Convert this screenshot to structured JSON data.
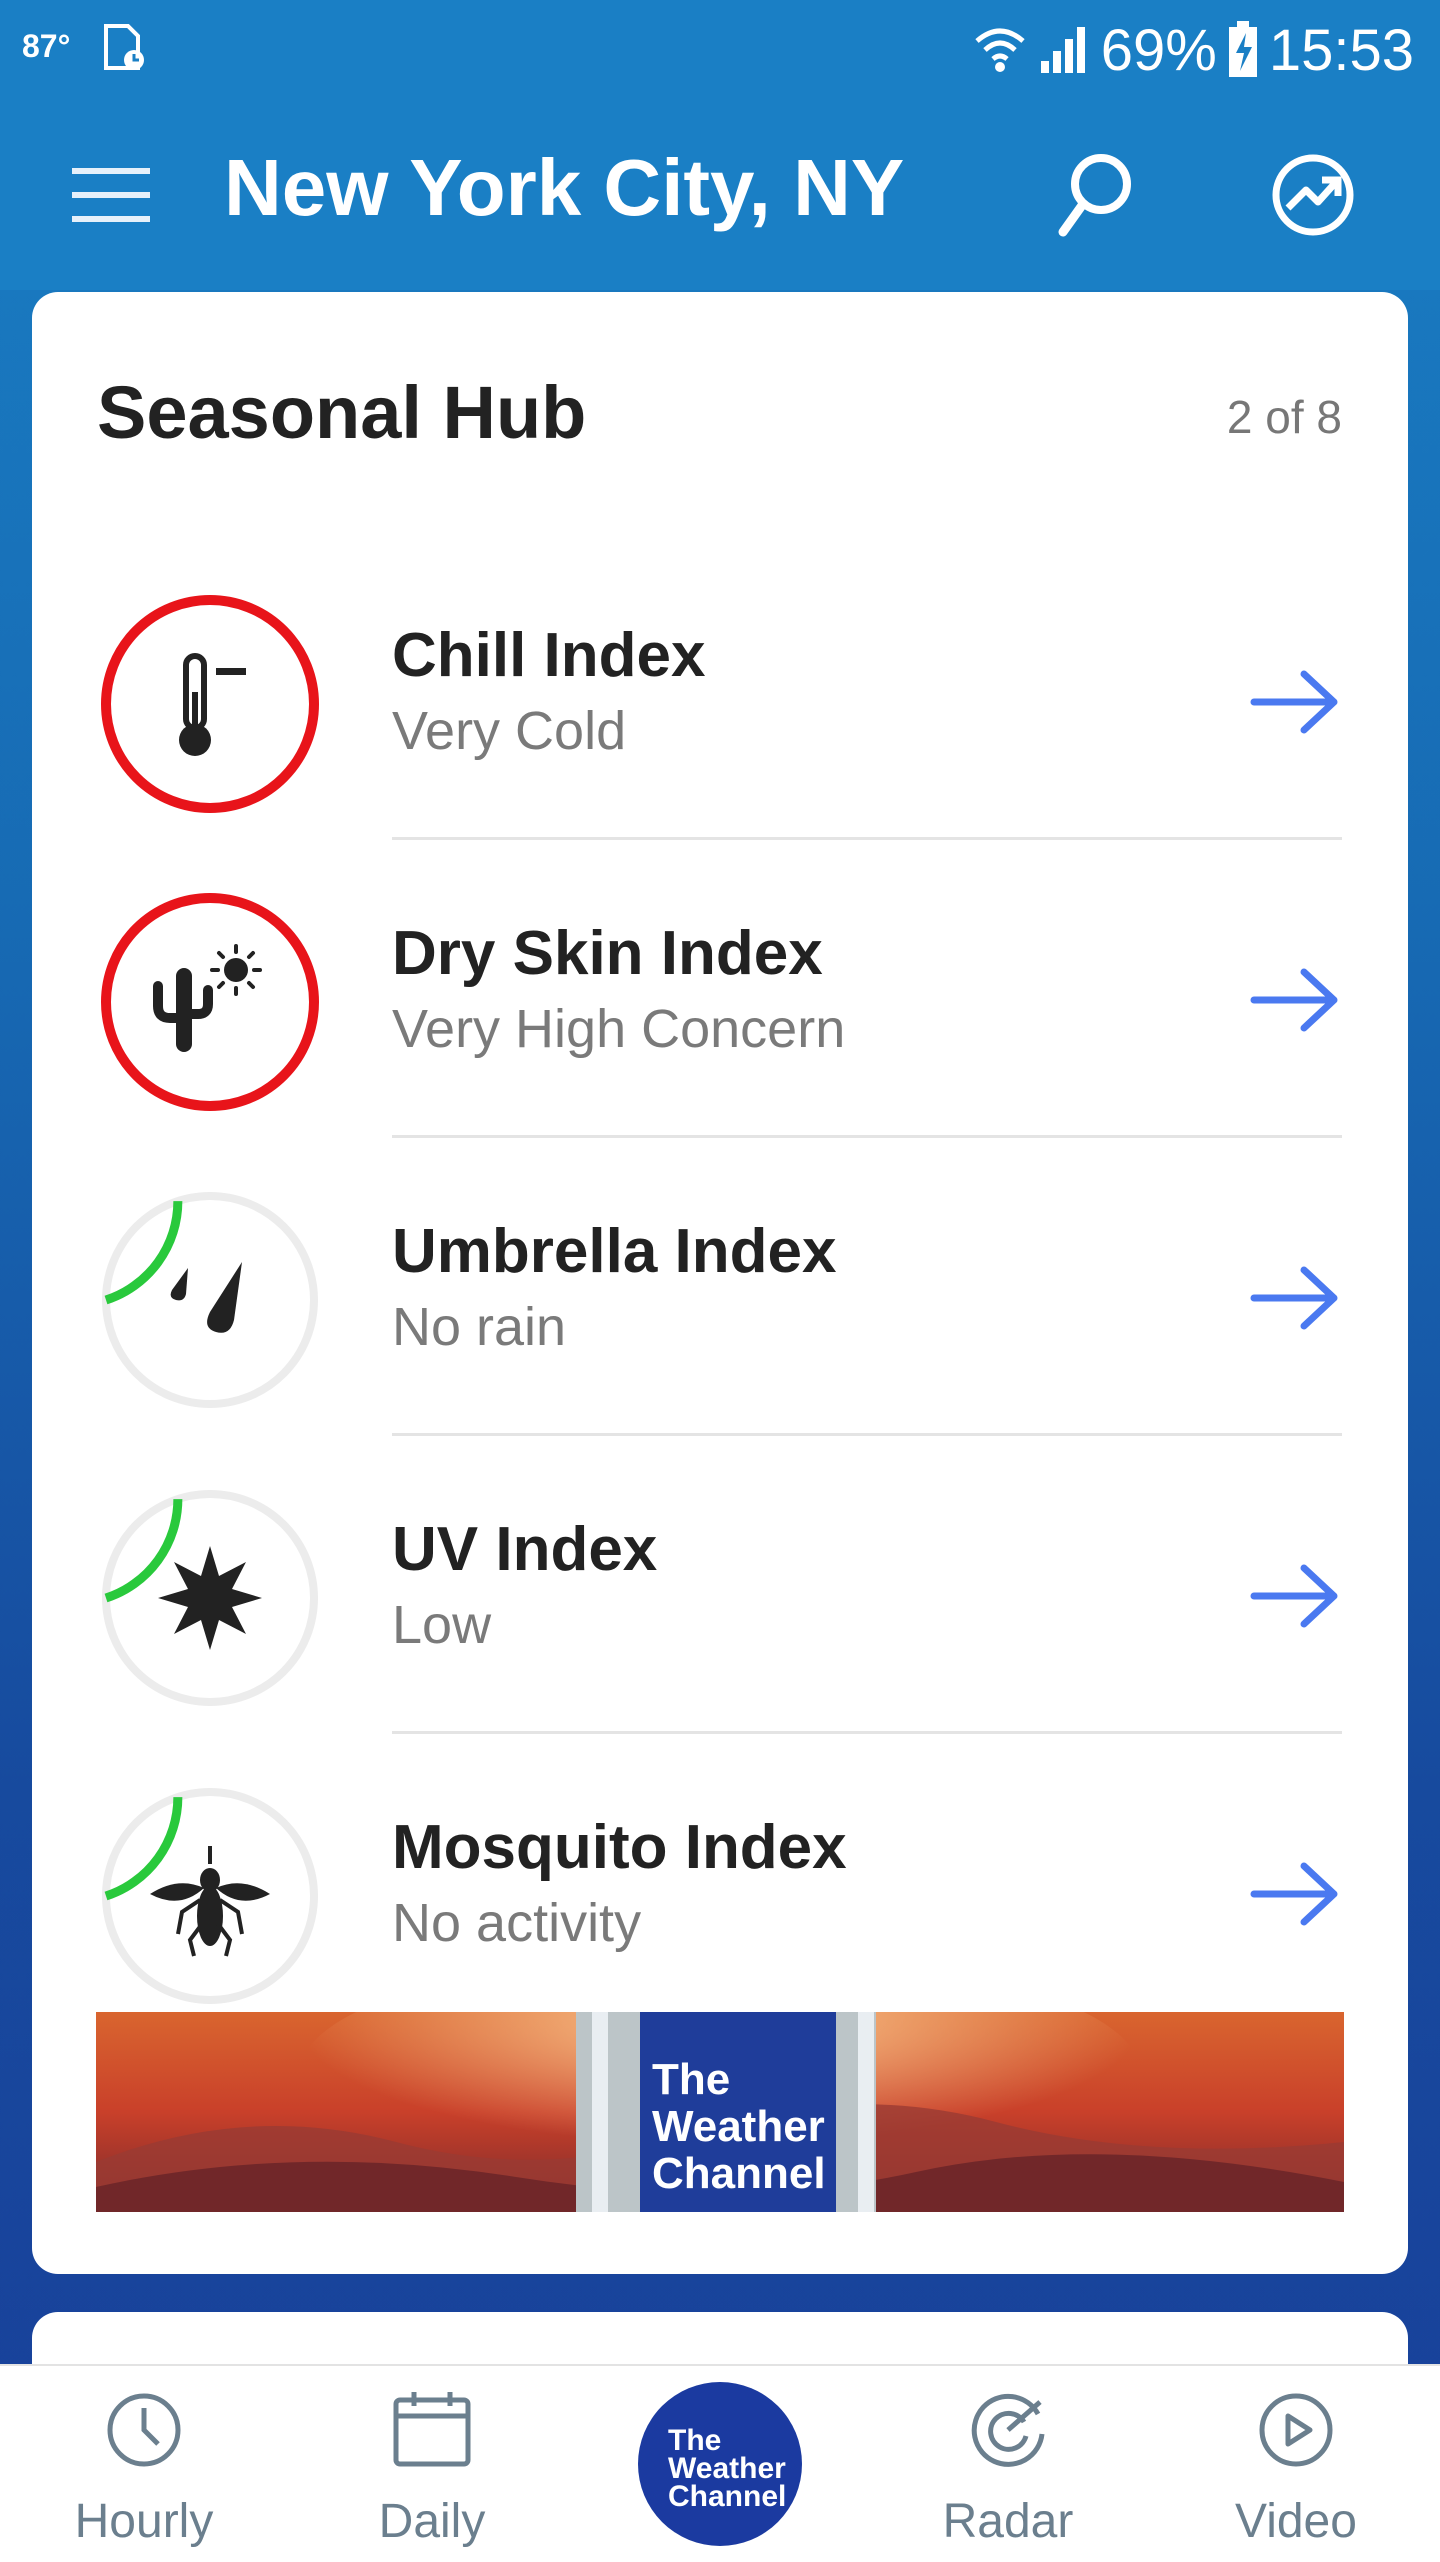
{
  "status_bar": {
    "temperature": "87°",
    "battery": "69%",
    "time": "15:53"
  },
  "header": {
    "menu_icon": "hamburger-menu-icon",
    "city": "New York City, NY",
    "search_icon": "search-icon",
    "trend_icon": "trending-icon"
  },
  "card": {
    "title": "Seasonal Hub",
    "count": "2 of 8",
    "rows": [
      {
        "title": "Chill Index",
        "value": "Very Cold",
        "icon": "thermometer-icon",
        "level": 1.0,
        "color": "#e8141a"
      },
      {
        "title": "Dry Skin Index",
        "value": "Very High Concern",
        "icon": "cactus-sun-icon",
        "level": 1.0,
        "color": "#e8141a"
      },
      {
        "title": "Umbrella Index",
        "value": "No rain",
        "icon": "raindrops-icon",
        "level": 0.2,
        "color": "#29c93c"
      },
      {
        "title": "UV Index",
        "value": "Low",
        "icon": "sun-star-icon",
        "level": 0.2,
        "color": "#29c93c"
      },
      {
        "title": "Mosquito Index",
        "value": "No activity",
        "icon": "mosquito-icon",
        "level": 0.2,
        "color": "#29c93c"
      }
    ],
    "banner": {
      "logo_lines": [
        "The",
        "Weather",
        "Channel"
      ]
    }
  },
  "nav": {
    "tabs": [
      {
        "label": "Hourly",
        "icon": "clock-icon"
      },
      {
        "label": "Daily",
        "icon": "calendar-icon"
      },
      {
        "label": "Radar",
        "icon": "radar-icon"
      },
      {
        "label": "Video",
        "icon": "play-icon"
      }
    ],
    "center_logo_lines": [
      "The",
      "Weather",
      "Channel"
    ]
  },
  "colors": {
    "header_blue": "#1a7fc5",
    "arrow_blue": "#4a79f0",
    "alert_red": "#e8141a",
    "ok_green": "#29c93c",
    "brand_navy": "#1b3aa0"
  }
}
